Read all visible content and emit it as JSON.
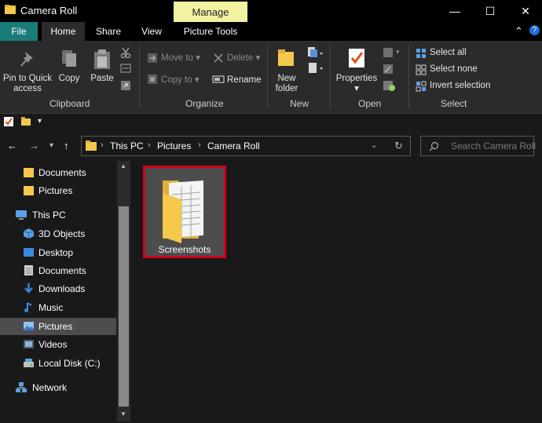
{
  "window": {
    "title": "Camera Roll",
    "context_tab": "Manage",
    "minimize_icon": "—",
    "maximize_icon": "☐",
    "close_icon": "✕"
  },
  "ribbon_tabs": {
    "file": "File",
    "home": "Home",
    "share": "Share",
    "view": "View",
    "picture_tools": "Picture Tools",
    "collapse_glyph": "⌃",
    "help_glyph": "?"
  },
  "ribbon": {
    "clipboard": {
      "pin_label": "Pin to Quick access",
      "copy_label": "Copy",
      "paste_label": "Paste",
      "group": "Clipboard"
    },
    "organize": {
      "move_to": "Move to",
      "copy_to": "Copy to",
      "delete": "Delete",
      "rename": "Rename",
      "group": "Organize"
    },
    "new": {
      "new_folder": "New folder",
      "group": "New"
    },
    "open": {
      "properties": "Properties",
      "group": "Open"
    },
    "select": {
      "select_all": "Select all",
      "select_none": "Select none",
      "invert": "Invert selection",
      "group": "Select"
    }
  },
  "address": {
    "crumbs": [
      "This PC",
      "Pictures",
      "Camera Roll"
    ],
    "search_placeholder": "Search Camera Roll"
  },
  "nav_tree": [
    {
      "label": "Documents",
      "icon": "folder-icon"
    },
    {
      "label": "Pictures",
      "icon": "folder-icon"
    },
    {
      "label": "This PC",
      "icon": "computer-icon"
    },
    {
      "label": "3D Objects",
      "icon": "3d-objects-icon"
    },
    {
      "label": "Desktop",
      "icon": "desktop-icon"
    },
    {
      "label": "Documents",
      "icon": "documents-icon"
    },
    {
      "label": "Downloads",
      "icon": "download-icon"
    },
    {
      "label": "Music",
      "icon": "music-icon"
    },
    {
      "label": "Pictures",
      "icon": "pictures-icon"
    },
    {
      "label": "Videos",
      "icon": "videos-icon"
    },
    {
      "label": "Local Disk (C:)",
      "icon": "drive-icon"
    },
    {
      "label": "Network",
      "icon": "network-icon"
    }
  ],
  "content": {
    "items": [
      {
        "name": "Screenshots",
        "icon": "folder-icon"
      }
    ]
  },
  "colors": {
    "accent": "#1a7c79",
    "manage_tab": "#f2f2a3",
    "selection_border": "#d0021b",
    "folder_yellow": "#f5c84c"
  }
}
